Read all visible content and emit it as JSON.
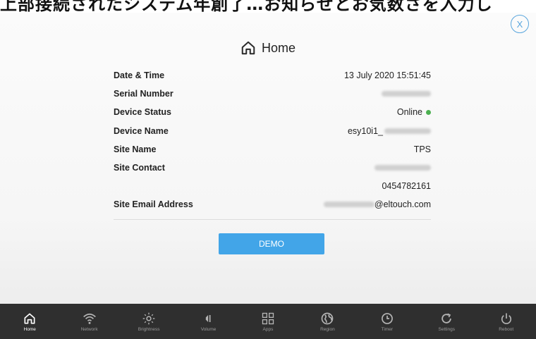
{
  "banner": {
    "text": "上部接続されたシステム年創了…お知らせとお気数さを入力し"
  },
  "dialog": {
    "close_label": "X",
    "title": "Home",
    "rows": [
      {
        "label": "Date & Time",
        "value": "13 July 2020 15:51:45"
      },
      {
        "label": "Serial Number",
        "value": ""
      },
      {
        "label": "Device Status",
        "value": "Online"
      },
      {
        "label": "Device Name",
        "value": "esy10i1_"
      },
      {
        "label": "Site Name",
        "value": "TPS"
      },
      {
        "label": "Site Contact",
        "value": ""
      },
      {
        "label": "",
        "value": "0454782161"
      },
      {
        "label": "Site Email Address",
        "value": "@eltouch.com"
      }
    ],
    "demo_button_label": "DEMO"
  },
  "status_color": "#4caf50",
  "accent_color": "#42a5e8",
  "nav": {
    "items": [
      {
        "label": "Home",
        "icon": "home-icon",
        "active": true
      },
      {
        "label": "Network",
        "icon": "wifi-icon"
      },
      {
        "label": "Brightness",
        "icon": "brightness-icon"
      },
      {
        "label": "Volume",
        "icon": "volume-icon"
      },
      {
        "label": "Apps",
        "icon": "apps-icon"
      },
      {
        "label": "Region",
        "icon": "globe-icon"
      },
      {
        "label": "Timer",
        "icon": "timer-icon"
      },
      {
        "label": "Settings",
        "icon": "settings-icon"
      },
      {
        "label": "Reboot",
        "icon": "power-icon"
      }
    ]
  }
}
